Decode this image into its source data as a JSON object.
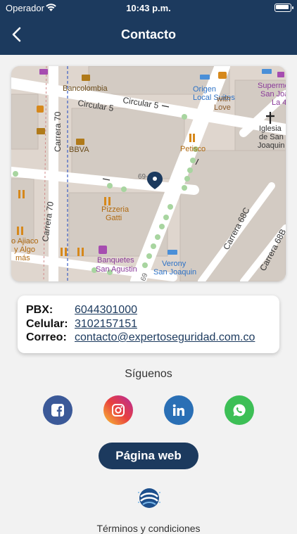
{
  "status_bar": {
    "carrier": "Operador",
    "time": "10:43 p.m."
  },
  "header": {
    "title": "Contacto"
  },
  "map": {
    "labels": {
      "bancolombia": "Bancolombia",
      "circular5_a": "Circular 5",
      "circular5_b": "Circular 5",
      "carrera70_a": "Carrera 70",
      "carrera70_b": "Carrera 70",
      "bbva": "BBVA",
      "petisco": "Petisco",
      "pizzeria1": "Pizzeria",
      "pizzeria2": "Gatti",
      "banquetes1": "Banquetes",
      "banquetes2": "San Agustin",
      "verony1": "Verony",
      "verony2": "San Joaquin",
      "origen1": "Origen",
      "origen2": "Local Suites",
      "withlove": "Love",
      "with": "with",
      "iglesia1": "Iglesia",
      "iglesia2": "de San",
      "iglesia3": "Joaquin",
      "super1": "Superme",
      "super2": "San Joa",
      "super3": "La 4",
      "carrera68c": "Carrera 68C",
      "carrera68b": "Carrera 68B",
      "ajiaco1": "o Ajiaco",
      "ajiaco2": "y Algo",
      "ajiaco3": "más",
      "num69": "69-",
      "num69b": "69"
    },
    "pin_color": "#1c3a5e"
  },
  "contact": {
    "pbx_label": "PBX:",
    "pbx_value": "6044301000",
    "cel_label": "Celular:",
    "cel_value": "3102157151",
    "mail_label": "Correo:",
    "mail_value": "contacto@expertoseguridad.com.co"
  },
  "follow_label": "Síguenos",
  "social": {
    "facebook_color": "#3b5998",
    "linkedin_color": "#2a6fb5",
    "whatsapp_color": "#3dbf56"
  },
  "web_button": "Página web",
  "terms": "Términos y condiciones"
}
